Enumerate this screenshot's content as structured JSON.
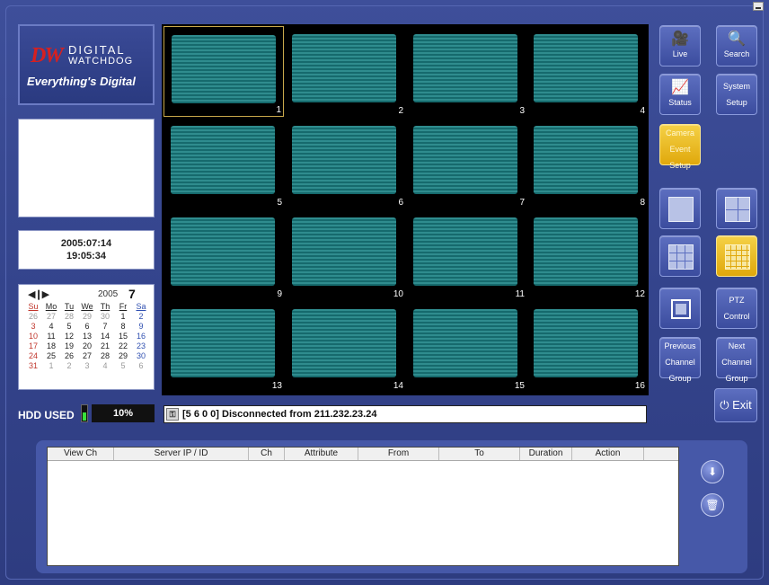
{
  "logo": {
    "dw": "DW",
    "brand_line1": "DIGITAL",
    "brand_line2": "WATCHDOG",
    "tagline": "Everything's Digital"
  },
  "datetime": {
    "date": "2005:07:14",
    "time": "19:05:34"
  },
  "calendar": {
    "nav": "◀❙▶",
    "year": "2005",
    "month": "7",
    "weekdays": [
      "Su",
      "Mo",
      "Tu",
      "We",
      "Th",
      "Fr",
      "Sa"
    ],
    "weeks": [
      [
        "26",
        "27",
        "28",
        "29",
        "30",
        "1",
        "2"
      ],
      [
        "3",
        "4",
        "5",
        "6",
        "7",
        "8",
        "9"
      ],
      [
        "10",
        "11",
        "12",
        "13",
        "14",
        "15",
        "16"
      ],
      [
        "17",
        "18",
        "19",
        "20",
        "21",
        "22",
        "23"
      ],
      [
        "24",
        "25",
        "26",
        "27",
        "28",
        "29",
        "30"
      ],
      [
        "31",
        "1",
        "2",
        "3",
        "4",
        "5",
        "6"
      ]
    ]
  },
  "hdd": {
    "label": "HDD USED",
    "value": "10%",
    "level": 0.1
  },
  "channels": [
    "1",
    "2",
    "3",
    "4",
    "5",
    "6",
    "7",
    "8",
    "9",
    "10",
    "11",
    "12",
    "13",
    "14",
    "15",
    "16"
  ],
  "status": {
    "message": "[5 6 0 0] Disconnected from 211.232.23.24"
  },
  "buttons": {
    "live": "Live",
    "search": "Search",
    "status": "Status",
    "system_setup_1": "System",
    "system_setup_2": "Setup",
    "camera_1": "Camera",
    "camera_2": "Event",
    "camera_3": "Setup",
    "ptz_1": "PTZ",
    "ptz_2": "Control",
    "prev_1": "Previous",
    "prev_2": "Channel",
    "prev_3": "Group",
    "next_1": "Next",
    "next_2": "Channel",
    "next_3": "Group",
    "exit": "Exit"
  },
  "table": {
    "columns": [
      "View Ch",
      "Server IP / ID",
      "Ch",
      "Attribute",
      "From",
      "To",
      "Duration",
      "Action"
    ]
  },
  "icons": {
    "live": "camera-icon",
    "search": "search-icon",
    "status": "chart-icon",
    "exit": "power-icon",
    "download": "download-icon",
    "delete": "trash-icon"
  }
}
